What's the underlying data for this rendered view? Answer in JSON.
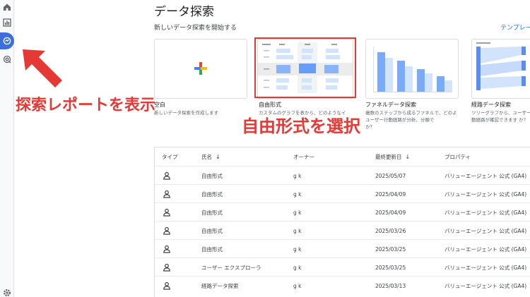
{
  "page": {
    "title": "データ探索",
    "subtitle": "新しいデータ探索を開始する",
    "template_link": "テンプレー"
  },
  "cards": [
    {
      "title": "空白",
      "desc": [
        "新しいデータ探索を作成します"
      ]
    },
    {
      "title": "自由形式",
      "desc": [
        "カスタムのグラフを表から、どのようなイ"
      ]
    },
    {
      "title": "ファネルデータ探索",
      "desc": [
        "複数のステップから成るファネルで、どのよ",
        "ユーザー行動経路が分析、分類で",
        "か？"
      ]
    },
    {
      "title": "経路データ探索",
      "desc": [
        "ツリーグラフから、ユーザー",
        "動経路が確認できます か？"
      ]
    }
  ],
  "annotations": {
    "left": "探索レポートを表示",
    "right": "自由形式を選択"
  },
  "table": {
    "headers": {
      "type": "タイプ",
      "name": "氏名",
      "owner": "オーナー",
      "updated": "最終更新日",
      "property": "プロパティ"
    },
    "rows": [
      {
        "name": "自由形式",
        "owner": "g k",
        "updated": "2025/05/07",
        "property": "バリューエージェント 公式 (GA4)"
      },
      {
        "name": "自由形式",
        "owner": "g k",
        "updated": "2025/04/09",
        "property": "バリューエージェント 公式 (GA4)"
      },
      {
        "name": "自由形式",
        "owner": "g k",
        "updated": "2025/04/09",
        "property": "バリューエージェント 公式 (GA4)"
      },
      {
        "name": "自由形式",
        "owner": "g k",
        "updated": "2025/03/26",
        "property": "バリューエージェント 公式 (GA4)"
      },
      {
        "name": "自由形式",
        "owner": "g k",
        "updated": "2025/03/25",
        "property": "バリューエージェント 公式 (GA4)"
      },
      {
        "name": "ユーザー エクスプローラ",
        "owner": "g k",
        "updated": "2025/03/25",
        "property": "バリューエージェント 公式 (GA4)"
      },
      {
        "name": "経路データ探索",
        "owner": "g k",
        "updated": "2025/03/13",
        "property": "バリューエージェント 公式 (GA4)"
      }
    ]
  },
  "colors": {
    "accent": "#1a73e8",
    "annotation_red": "#e53935",
    "rail_active": "#3c6fd8"
  },
  "icons": {
    "rail": [
      "home-icon",
      "reports-icon",
      "explore-icon",
      "advertising-icon",
      "settings-icon"
    ],
    "row_type": "person-icon",
    "blank_card": "plus-icon"
  }
}
